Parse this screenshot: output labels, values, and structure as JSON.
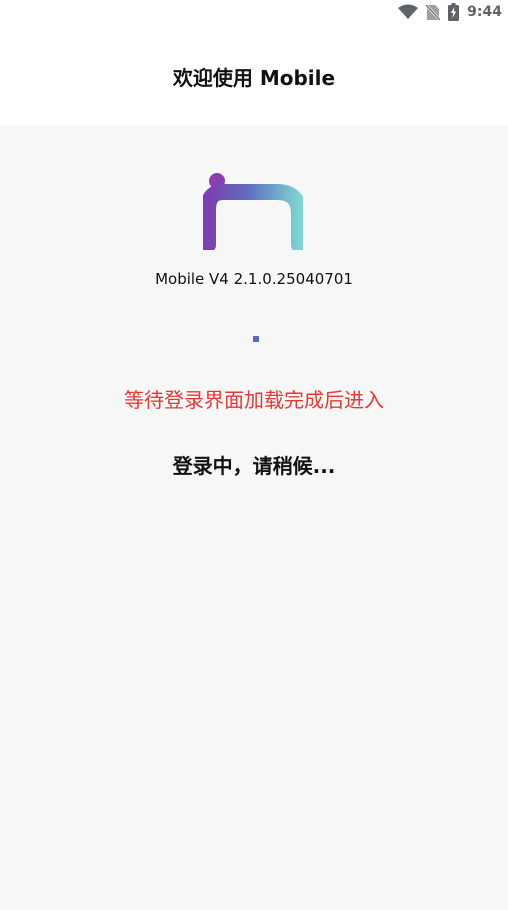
{
  "status_bar": {
    "time": "9:44",
    "icons": [
      "wifi-icon",
      "no-sim-icon",
      "battery-charging-icon"
    ]
  },
  "header": {
    "title": "欢迎使用 Mobile"
  },
  "splash": {
    "logo_icon": "im-logo-icon",
    "version": "Mobile V4 2.1.0.25040701",
    "hint": "等待登录界面加载完成后进入",
    "loading_text": "登录中，请稍候..."
  },
  "colors": {
    "hint": "#e53935",
    "spinner": "#5b6bbf",
    "logo_gradient": [
      "#7b3fb0",
      "#7fd3d1"
    ]
  }
}
